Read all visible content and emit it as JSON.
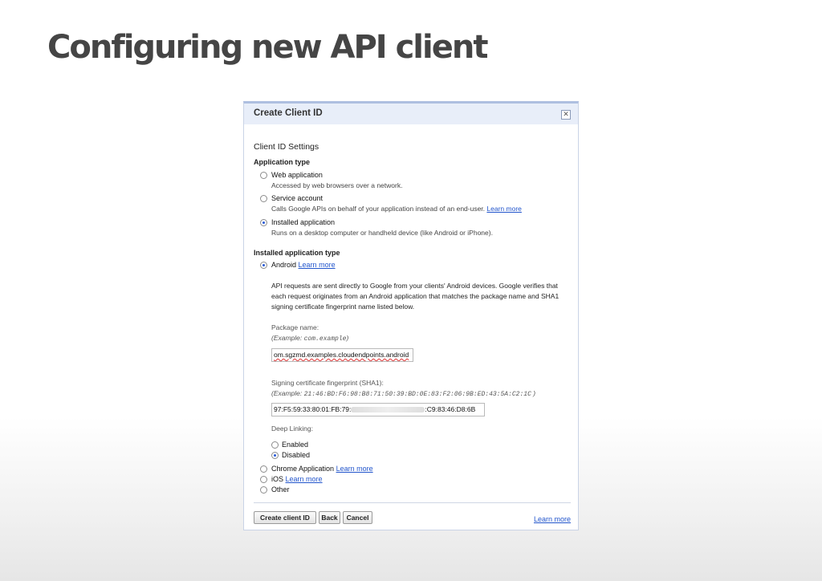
{
  "slide": {
    "title": "Configuring new API client"
  },
  "dialog": {
    "title": "Create Client ID",
    "close_glyph": "✕",
    "section_title": "Client ID Settings",
    "app_type": {
      "title": "Application type",
      "options": [
        {
          "label": "Web application",
          "desc": "Accessed by web browsers over a network.",
          "selected": false
        },
        {
          "label": "Service account",
          "desc": "Calls Google APIs on behalf of your application instead of an end-user.",
          "link": "Learn more",
          "selected": false
        },
        {
          "label": "Installed application",
          "desc": "Runs on a desktop computer or handheld device (like Android or iPhone).",
          "selected": true
        }
      ]
    },
    "installed_type": {
      "title": "Installed application type",
      "android": {
        "label": "Android",
        "link": "Learn more",
        "selected": true
      },
      "description": "API requests are sent directly to Google from your clients' Android devices. Google verifies that each request originates from an Android application that matches the package name and SHA1 signing certificate fingerprint name listed below.",
      "package": {
        "label": "Package name:",
        "example_prefix": "(Example: ",
        "example_value": "com.example",
        "example_suffix": ")",
        "value": "om.sgzmd.examples.cloudendpoints.android"
      },
      "sha1": {
        "label": "Signing certificate fingerprint (SHA1):",
        "example_prefix": "(Example: ",
        "example_value": "21:46:BD:F6:98:B8:71:50:39:BD:0E:83:F2:06:9B:ED:43:5A:C2:1C",
        "example_suffix": ")",
        "value_start": "97:F5:59:33:80:01:FB:79:",
        "value_end": ":C9:83:46:D8:6B"
      },
      "deep_linking": {
        "label": "Deep Linking:",
        "enabled": "Enabled",
        "disabled": "Disabled",
        "selected": "Disabled"
      },
      "chrome": {
        "label": "Chrome Application",
        "link": "Learn more"
      },
      "ios": {
        "label": "iOS",
        "link": "Learn more"
      },
      "other": {
        "label": "Other"
      }
    },
    "buttons": {
      "create": "Create client ID",
      "back": "Back",
      "cancel": "Cancel"
    },
    "footer_link": "Learn more"
  }
}
